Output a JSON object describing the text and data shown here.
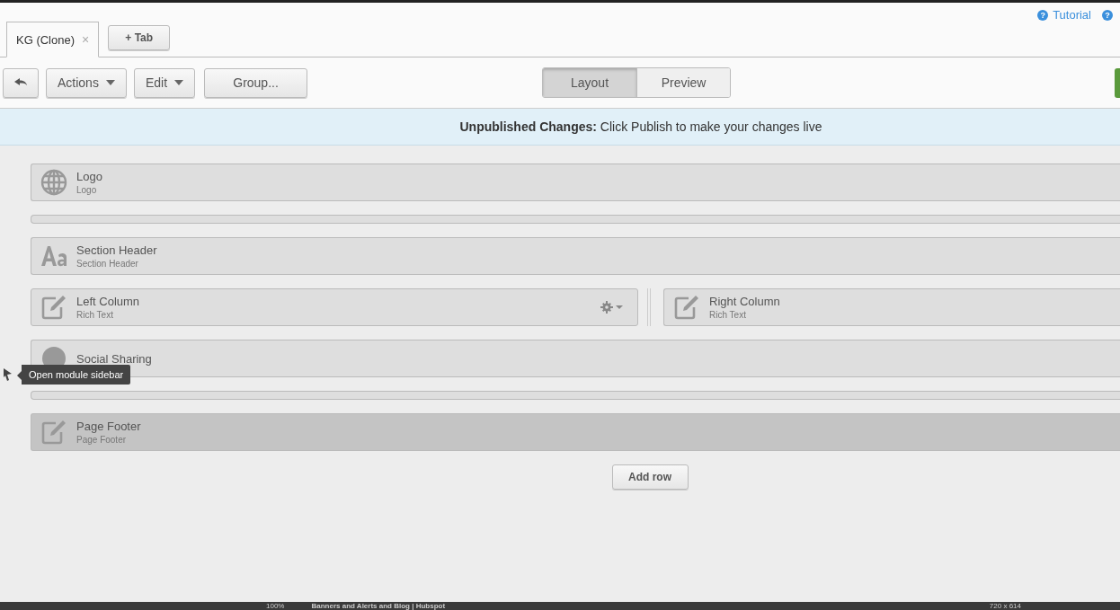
{
  "help_links": [
    {
      "symbol": "?",
      "label": "Tutorial",
      "kind": "link"
    },
    {
      "symbol": "?",
      "kind": "icon"
    }
  ],
  "tabs": [
    {
      "label": "KG (Clone)",
      "close": "×",
      "selected": true
    }
  ],
  "add_tab_button": "+ Tab",
  "toolbar": {
    "buttons": [
      {
        "kind": "back"
      },
      {
        "label": "Actions",
        "kind": "dropdown"
      },
      {
        "label": "Edit",
        "kind": "dropdown"
      },
      {
        "label": "Group...",
        "kind": "wide"
      }
    ],
    "view_toggle": [
      {
        "label": "Layout",
        "selected": true
      },
      {
        "label": "Preview",
        "selected": false
      }
    ]
  },
  "banner": {
    "text": "**Unpublished Changes:** Click Publish to make your changes live"
  },
  "rows": [
    {
      "kind": "module",
      "title": "Logo",
      "subtitle": "Logo",
      "highlighted": false
    },
    {
      "kind": "spacer"
    },
    {
      "kind": "module",
      "title": "Section Header",
      "subtitle": "Section Header",
      "highlighted": false
    },
    {
      "kind": "columns",
      "columns": [
        {
          "title": "Left Column",
          "subtitle": "Rich Text",
          "settings": true
        },
        {
          "title": "Right Column",
          "subtitle": "Rich Text"
        }
      ]
    },
    {
      "kind": "module",
      "title": "Social Sharing",
      "highlighted": false
    },
    {
      "kind": "spacer"
    },
    {
      "kind": "module",
      "title": "Page Footer",
      "subtitle": "Page Footer",
      "highlighted": true
    }
  ],
  "add_row_button": "Add row",
  "tooltip": "Open module sidebar",
  "bottom_strip": [
    "100%",
    "Banners and Alerts and Blog | Hubspot",
    "720 x 614"
  ]
}
